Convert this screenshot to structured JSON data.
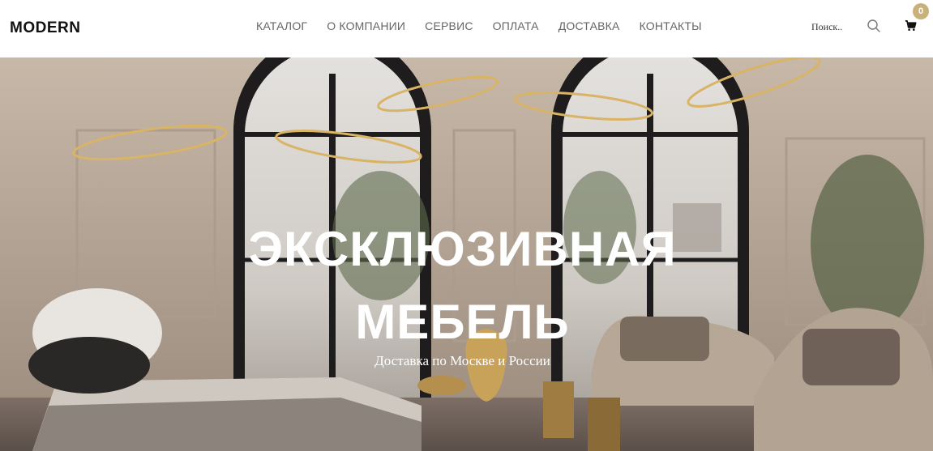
{
  "header": {
    "logo": "MODERN",
    "nav": [
      "КАТАЛОГ",
      "О КОМПАНИИ",
      "СЕРВИС",
      "ОПЛАТА",
      "ДОСТАВКА",
      "КОНТАКТЫ"
    ],
    "search": {
      "placeholder": "Поиск.."
    },
    "cart": {
      "count": "0",
      "badge_color": "#c9b17b"
    }
  },
  "hero": {
    "title_line1": "ЭКСКЛЮЗИВНАЯ",
    "title_line2": "МЕБЕЛЬ",
    "subtitle": "Доставка по Москве и России"
  }
}
